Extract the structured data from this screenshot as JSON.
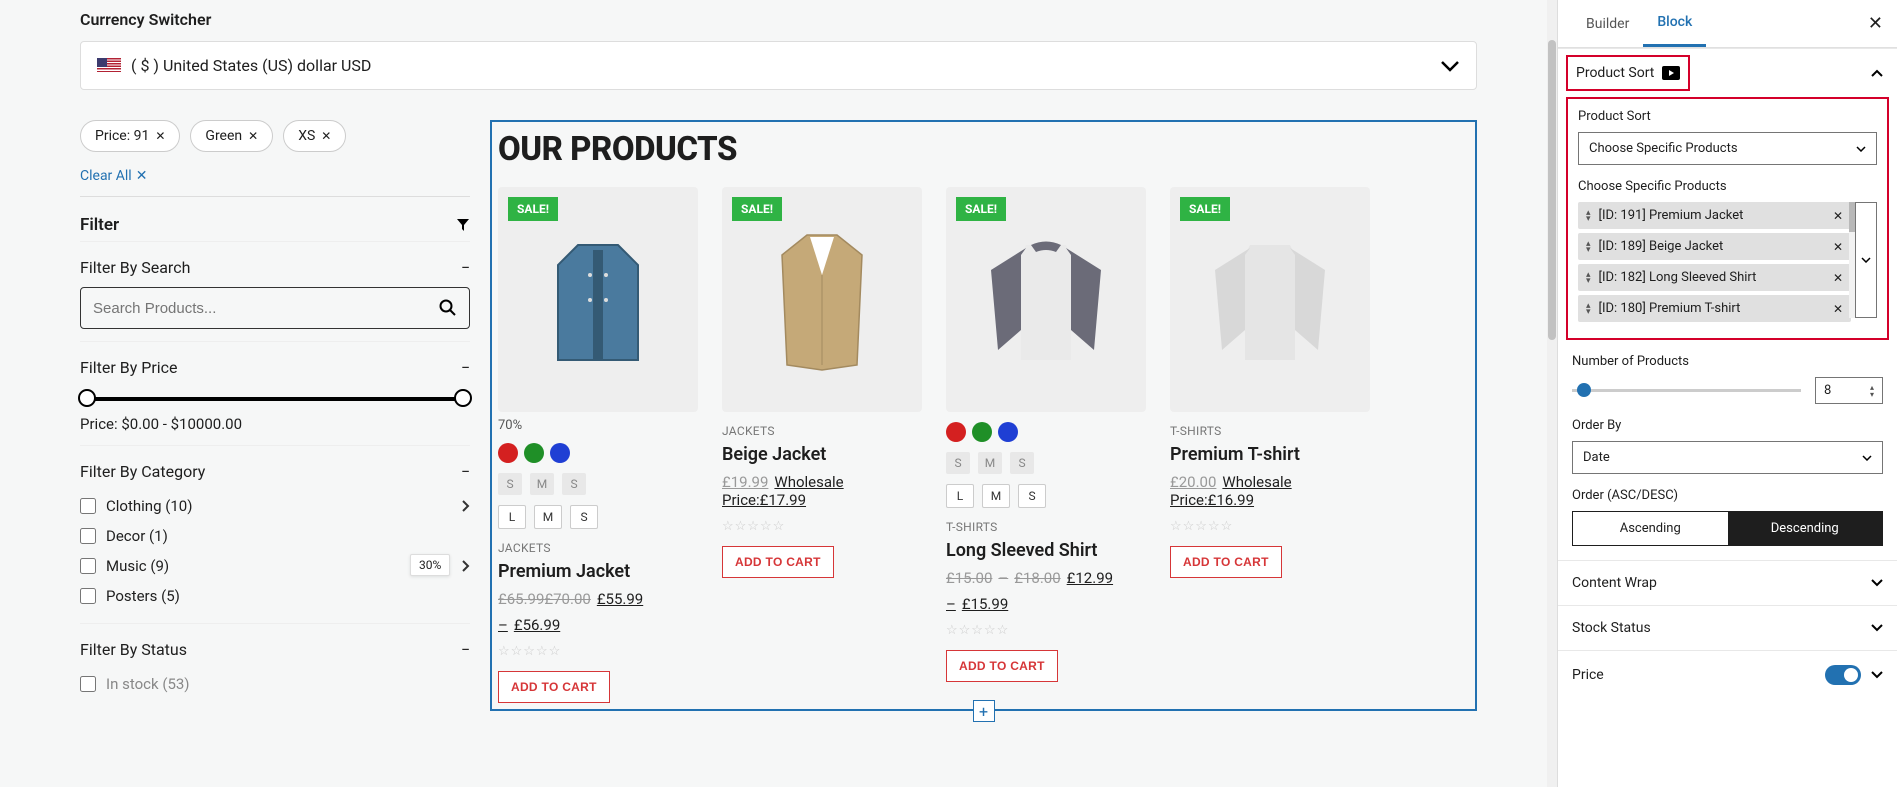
{
  "currency": {
    "title": "Currency Switcher",
    "value": "( $ ) United States (US) dollar USD"
  },
  "tags": [
    "Price: 91",
    "Green",
    "XS"
  ],
  "clear_all": "Clear All",
  "filter_label": "Filter",
  "filters": {
    "search": {
      "title": "Filter By Search",
      "placeholder": "Search Products..."
    },
    "price": {
      "title": "Filter By Price",
      "text": "Price: $0.00 - $10000.00"
    },
    "category": {
      "title": "Filter By Category",
      "items": [
        "Clothing (10)",
        "Decor (1)",
        "Music (9)",
        "Posters (5)"
      ]
    },
    "status": {
      "title": "Filter By Status",
      "items": [
        "In stock (53)"
      ]
    }
  },
  "products_title": "OUR PRODUCTS",
  "sale_label": "SALE!",
  "add_to_cart": "ADD TO CART",
  "wholesale_label": "Wholesale",
  "sizes_sm": [
    "S",
    "M",
    "S"
  ],
  "sizes_lms": [
    "L",
    "M",
    "S"
  ],
  "discount70": "70%",
  "discount30": "30%",
  "products": [
    {
      "cat": "JACKETS",
      "name": "Premium Jacket",
      "old1": "£65.99",
      "old2": "£70.00",
      "new1": "£55.99",
      "new2": "£56.99",
      "wholesale_price": "",
      "colors": [
        "#d42020",
        "#1f8f27",
        "#1f3fd4"
      ]
    },
    {
      "cat": "JACKETS",
      "name": "Beige Jacket",
      "old1": "£19.99",
      "wholesale_price": "Price:£17.99",
      "colors": []
    },
    {
      "cat": "T-SHIRTS",
      "name": "Long Sleeved Shirt",
      "old1": "£15.00",
      "old2": "£18.00",
      "new1": "£12.99",
      "new2": "£15.99",
      "colors": [
        "#d42020",
        "#1f8f27",
        "#1f3fd4"
      ]
    },
    {
      "cat": "T-SHIRTS",
      "name": "Premium T-shirt",
      "old1": "£20.00",
      "wholesale_price": "Price:£16.99",
      "colors": []
    }
  ],
  "panel": {
    "tabs": {
      "builder": "Builder",
      "block": "Block"
    },
    "section_title": "Product Sort",
    "sort_label": "Product Sort",
    "sort_value": "Choose Specific Products",
    "choose_label": "Choose Specific Products",
    "chosen": [
      "[ID: 191] Premium Jacket",
      "[ID: 189] Beige Jacket",
      "[ID: 182] Long Sleeved Shirt",
      "[ID: 180] Premium T-shirt"
    ],
    "num_label": "Number of Products",
    "num_value": "8",
    "orderby_label": "Order By",
    "orderby_value": "Date",
    "order_label": "Order (ASC/DESC)",
    "order_asc": "Ascending",
    "order_desc": "Descending",
    "sections": {
      "content_wrap": "Content Wrap",
      "stock_status": "Stock Status",
      "price": "Price"
    }
  }
}
